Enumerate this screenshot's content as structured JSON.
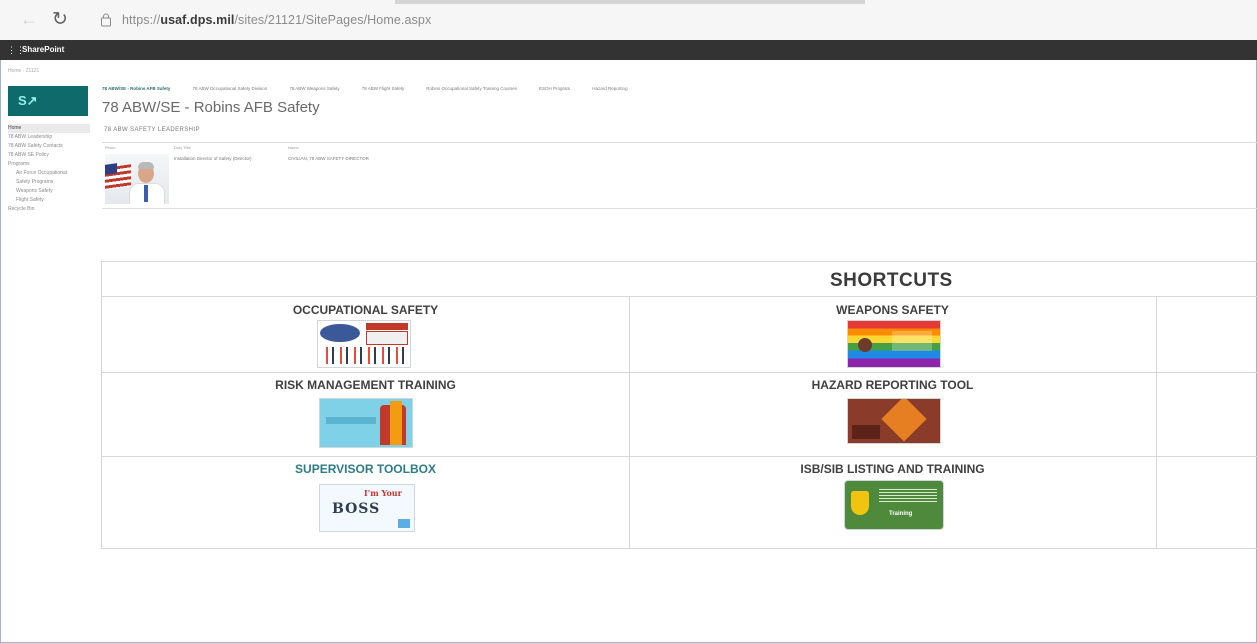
{
  "browser": {
    "url_prefix": "https://",
    "url_host": "usaf.dps.mil",
    "url_path": "/sites/21121/SitePages/Home.aspx"
  },
  "suite": {
    "brand": "SharePoint"
  },
  "breadcrumb": "Home · 21121",
  "left_nav": [
    {
      "label": "Home",
      "selected": true,
      "sub": false
    },
    {
      "label": "78 ABW Leadership",
      "selected": false,
      "sub": false
    },
    {
      "label": "78 ABW Safety Contacts",
      "selected": false,
      "sub": false
    },
    {
      "label": "78 ABW SE Policy",
      "selected": false,
      "sub": false
    },
    {
      "label": "Programs",
      "selected": false,
      "sub": false
    },
    {
      "label": "Air Force Occupational",
      "selected": false,
      "sub": true
    },
    {
      "label": "Safety Programs",
      "selected": false,
      "sub": true
    },
    {
      "label": "Weapons Safety",
      "selected": false,
      "sub": true
    },
    {
      "label": "Flight Safety",
      "selected": false,
      "sub": true
    },
    {
      "label": "Recycle Bin",
      "selected": false,
      "sub": false
    }
  ],
  "top_nav": [
    "78 ABW/SE - Robins AFB Safety",
    "78 ABW Occupational Safety Division",
    "78 ABW Weapons Safety",
    "78 ABW Flight Safety",
    "Robins Occupational Safety Training Courses",
    "ESOH Program",
    "Hazard Reporting"
  ],
  "site_title": "78 ABW/SE - Robins AFB Safety",
  "section_label": "78 ABW SAFETY LEADERSHIP",
  "leadership": {
    "headers": [
      "Photo",
      "Duty Title",
      "Name"
    ],
    "duty_title": "Installation Director of Safety (Director)",
    "name": "CIVILIAN, 78 ABW SAFETY DIRECTOR"
  },
  "shortcuts": {
    "title": "SHORTCUTS",
    "items": [
      {
        "label": "OCCUPATIONAL SAFETY",
        "link": false
      },
      {
        "label": "WEAPONS SAFETY",
        "link": false
      },
      {
        "label": "RISK MANAGEMENT TRAINING",
        "link": false
      },
      {
        "label": "HAZARD REPORTING TOOL",
        "link": false
      },
      {
        "label": "SUPERVISOR TOOLBOX",
        "link": true
      },
      {
        "label": "ISB/SIB LISTING AND TRAINING",
        "link": false
      }
    ],
    "thumbs": {
      "supervisor_text": "BOSS",
      "supervisor_red": "I'm Your",
      "isb_caption": "Training"
    }
  },
  "icons": [
    "back-icon",
    "reload-icon",
    "site-info-icon",
    "waffle-icon"
  ]
}
